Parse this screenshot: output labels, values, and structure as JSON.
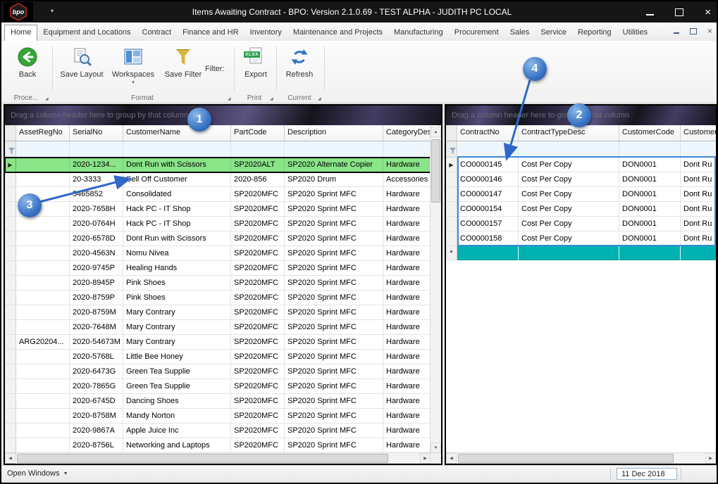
{
  "titlebar": {
    "title": "Items Awaiting Contract - BPO: Version 2.1.0.69 - TEST ALPHA - JUDITH PC LOCAL",
    "logo_text": "bpo"
  },
  "menubar": {
    "tabs": [
      "Home",
      "Equipment and Locations",
      "Contract",
      "Finance and HR",
      "Inventory",
      "Maintenance and Projects",
      "Manufacturing",
      "Procurement",
      "Sales",
      "Service",
      "Reporting",
      "Utilities"
    ],
    "active_tab": "Home"
  },
  "ribbon": {
    "back_label": "Back",
    "save_layout_label": "Save Layout",
    "workspaces_label": "Workspaces",
    "save_filter_label": "Save Filter",
    "filter_label": "Filter:",
    "export_label": "Export",
    "export_badge": "XLSX",
    "refresh_label": "Refresh",
    "groups": {
      "process": "Proce...",
      "format": "Format",
      "print": "Print",
      "current": "Current"
    }
  },
  "left_grid": {
    "group_hint": "Drag a column header here to group by that column",
    "columns": [
      "AssetRegNo",
      "SerialNo",
      "CustomerName",
      "PartCode",
      "Description",
      "CategoryDesc"
    ],
    "rows": [
      {
        "selected": true,
        "indicator": "▶",
        "cells": [
          "",
          "2020-1234...",
          "Dont Run with Scissors",
          "SP2020ALT",
          "SP2020 Alternate Copier",
          "Hardware"
        ]
      },
      {
        "cells": [
          "",
          "20-3333",
          "Sell Off Customer",
          "2020-856",
          "SP2020 Drum",
          "Accessories"
        ]
      },
      {
        "cells": [
          "",
          "5465852",
          "Consolidated",
          "SP2020MFC",
          "SP2020 Sprint MFC",
          "Hardware"
        ]
      },
      {
        "cells": [
          "",
          "2020-7658H",
          "Hack PC - IT Shop",
          "SP2020MFC",
          "SP2020 Sprint MFC",
          "Hardware"
        ]
      },
      {
        "cells": [
          "",
          "2020-0764H",
          "Hack PC - IT Shop",
          "SP2020MFC",
          "SP2020 Sprint MFC",
          "Hardware"
        ]
      },
      {
        "cells": [
          "",
          "2020-6578D",
          "Dont Run with Scissors",
          "SP2020MFC",
          "SP2020 Sprint MFC",
          "Hardware"
        ]
      },
      {
        "cells": [
          "",
          "2020-4563N",
          "Nomu Nivea",
          "SP2020MFC",
          "SP2020 Sprint MFC",
          "Hardware"
        ]
      },
      {
        "cells": [
          "",
          "2020-9745P",
          "Healing Hands",
          "SP2020MFC",
          "SP2020 Sprint MFC",
          "Hardware"
        ]
      },
      {
        "cells": [
          "",
          "2020-8945P",
          "Pink Shoes",
          "SP2020MFC",
          "SP2020 Sprint MFC",
          "Hardware"
        ]
      },
      {
        "cells": [
          "",
          "2020-8759P",
          "Pink Shoes",
          "SP2020MFC",
          "SP2020 Sprint MFC",
          "Hardware"
        ]
      },
      {
        "cells": [
          "",
          "2020-8759M",
          "Mary Contrary",
          "SP2020MFC",
          "SP2020 Sprint MFC",
          "Hardware"
        ]
      },
      {
        "cells": [
          "",
          "2020-7648M",
          "Mary Contrary",
          "SP2020MFC",
          "SP2020 Sprint MFC",
          "Hardware"
        ]
      },
      {
        "cells": [
          "ARG20204...",
          "2020-54673M",
          "Mary Contrary",
          "SP2020MFC",
          "SP2020 Sprint MFC",
          "Hardware"
        ]
      },
      {
        "cells": [
          "",
          "2020-5768L",
          "Little Bee Honey",
          "SP2020MFC",
          "SP2020 Sprint MFC",
          "Hardware"
        ]
      },
      {
        "cells": [
          "",
          "2020-6473G",
          "Green Tea Supplie",
          "SP2020MFC",
          "SP2020 Sprint MFC",
          "Hardware"
        ]
      },
      {
        "cells": [
          "",
          "2020-7865G",
          "Green Tea Supplie",
          "SP2020MFC",
          "SP2020 Sprint MFC",
          "Hardware"
        ]
      },
      {
        "cells": [
          "",
          "2020-6745D",
          "Dancing Shoes",
          "SP2020MFC",
          "SP2020 Sprint MFC",
          "Hardware"
        ]
      },
      {
        "cells": [
          "",
          "2020-8758M",
          "Mandy Norton",
          "SP2020MFC",
          "SP2020 Sprint MFC",
          "Hardware"
        ]
      },
      {
        "cells": [
          "",
          "2020-9867A",
          "Apple Juice Inc",
          "SP2020MFC",
          "SP2020 Sprint MFC",
          "Hardware"
        ]
      },
      {
        "cells": [
          "",
          "2020-8756L",
          "Networking and Laptops",
          "SP2020MFC",
          "SP2020 Sprint MFC",
          "Hardware"
        ]
      }
    ]
  },
  "right_grid": {
    "group_hint": "Drag a column header here to group by that column",
    "columns": [
      "ContractNo",
      "ContractTypeDesc",
      "CustomerCode",
      "Customer"
    ],
    "rows": [
      {
        "indicator": "▶",
        "cells": [
          "CO0000145",
          "Cost Per Copy",
          "DON0001",
          "Dont Ru"
        ]
      },
      {
        "cells": [
          "CO0000146",
          "Cost Per Copy",
          "DON0001",
          "Dont Ru"
        ]
      },
      {
        "cells": [
          "CO0000147",
          "Cost Per Copy",
          "DON0001",
          "Dont Ru"
        ]
      },
      {
        "cells": [
          "CO0000154",
          "Cost Per Copy",
          "DON0001",
          "Dont Ru"
        ]
      },
      {
        "cells": [
          "CO0000157",
          "Cost Per Copy",
          "DON0001",
          "Dont Ru"
        ]
      },
      {
        "cells": [
          "CO0000158",
          "Cost Per Copy",
          "DON0001",
          "Dont Ru"
        ]
      },
      {
        "new_row": true,
        "indicator": "*",
        "cells": [
          "",
          "",
          "",
          ""
        ]
      }
    ]
  },
  "callouts": {
    "c1": "1",
    "c2": "2",
    "c3": "3",
    "c4": "4"
  },
  "statusbar": {
    "open_windows": "Open Windows",
    "date": "11 Dec 2018"
  }
}
